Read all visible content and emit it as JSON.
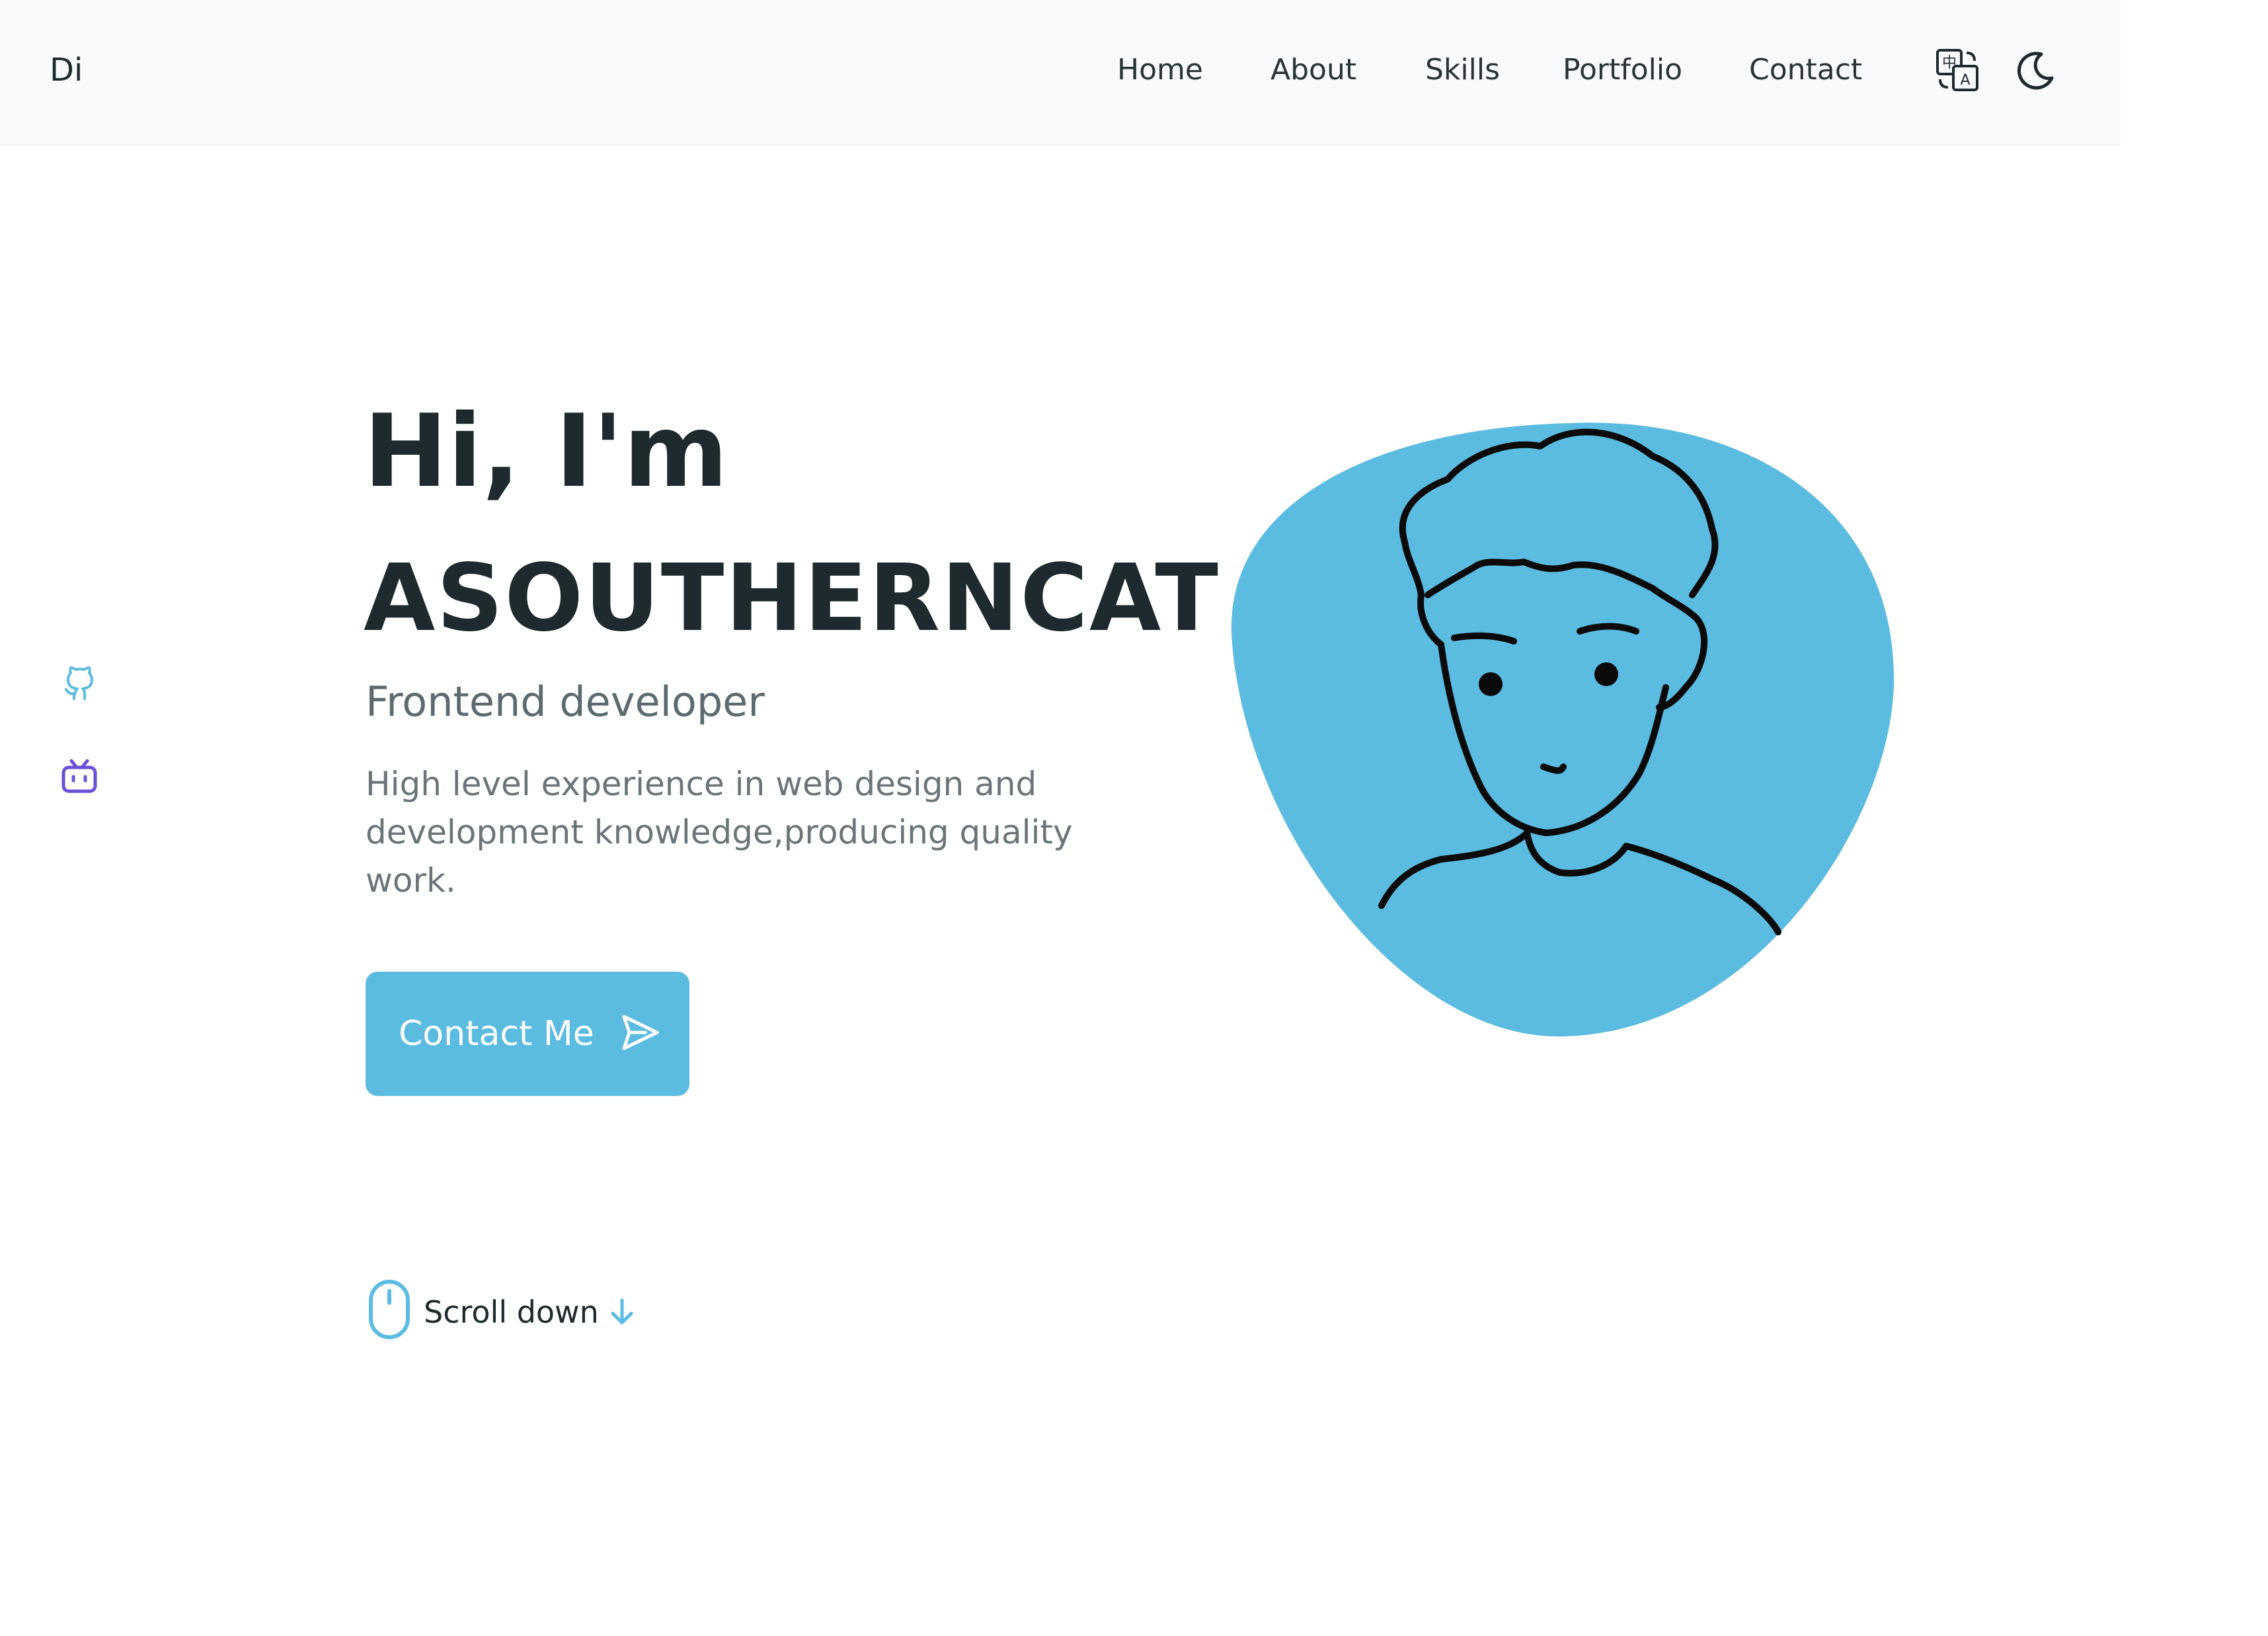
{
  "header": {
    "logo": "Di",
    "nav": [
      {
        "label": "Home"
      },
      {
        "label": "About"
      },
      {
        "label": "Skills"
      },
      {
        "label": "Portfolio"
      },
      {
        "label": "Contact"
      }
    ],
    "language_icon": "translate-icon",
    "theme_icon": "moon-icon"
  },
  "social": {
    "github_icon": "github-icon",
    "bilibili_icon": "bilibili-icon"
  },
  "hero": {
    "greeting": "Hi, I'm",
    "name": "ASOUTHERNCAT",
    "subtitle": "Frontend developer",
    "description": "High level experience in web design and development knowledge,producing quality work.",
    "button_label": "Contact Me",
    "button_icon": "send-icon"
  },
  "scroll": {
    "label": "Scroll down",
    "mouse_icon": "mouse-icon",
    "arrow_icon": "arrow-down-icon"
  },
  "avatar": {
    "icon": "avatar-illustration"
  },
  "colors": {
    "accent": "#5bbbe0",
    "text_dark": "#1f2a2e",
    "text_muted": "#6b7579",
    "header_bg": "#f9fafc",
    "bilibili": "#6b4fd8"
  }
}
